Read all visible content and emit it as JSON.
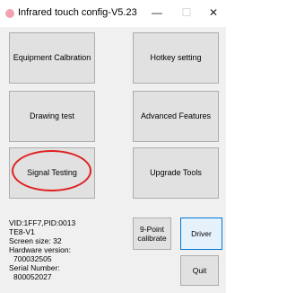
{
  "window": {
    "title": "Infrared touch config-V5.23",
    "minimize_glyph": "—",
    "maximize_glyph": "☐",
    "close_glyph": "✕"
  },
  "buttons": {
    "equipment_calibration": "Equipment Calbration",
    "hotkey_setting": "Hotkey setting",
    "drawing_test": "Drawing test",
    "advanced_features": "Advanced Features",
    "signal_testing": "Signal Testing",
    "upgrade_tools": "Upgrade Tools",
    "nine_point_line1": "9-Point",
    "nine_point_line2": "calibrate",
    "driver_check": "Driver check",
    "quit": "Quit"
  },
  "device_info": {
    "vid_pid": "VID:1FF7,PID:0013",
    "model": "TE8-V1",
    "screen_size": "Screen size: 32",
    "hardware_version_label": "Hardware version:",
    "hardware_version": "700032505",
    "serial_number_label": "Serial Number:",
    "serial_number": "800052027"
  },
  "colors": {
    "highlight": "#e02020",
    "focused_button_border": "#0078d7"
  }
}
